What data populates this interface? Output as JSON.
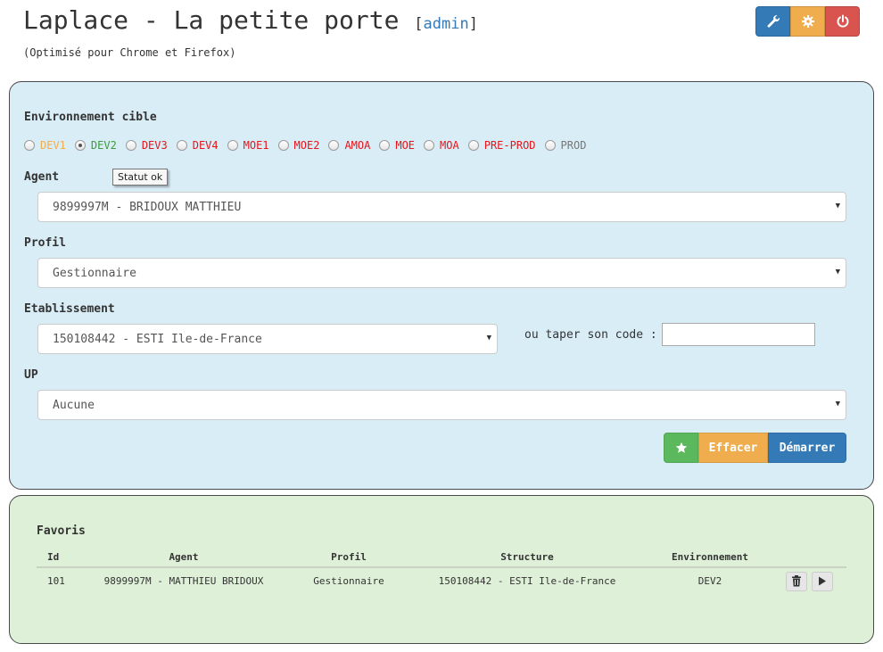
{
  "header": {
    "title": "Laplace - La petite porte",
    "bracket_open": "[",
    "admin_link": "admin",
    "bracket_close": "]",
    "subtitle": "(Optimisé pour Chrome et Firefox)"
  },
  "top_buttons": [
    {
      "icon": "wrench-icon",
      "color": "#337ab7"
    },
    {
      "icon": "gear-icon",
      "color": "#f0ad4e"
    },
    {
      "icon": "power-icon",
      "color": "#d9534f"
    }
  ],
  "form": {
    "env_label": "Environnement cible",
    "environments": [
      {
        "label": "DEV1",
        "color": "#f0ad4e",
        "checked": false
      },
      {
        "label": "DEV2",
        "color": "#3c9b3c",
        "checked": true
      },
      {
        "label": "DEV3",
        "color": "#e8141a",
        "checked": false
      },
      {
        "label": "DEV4",
        "color": "#e8141a",
        "checked": false
      },
      {
        "label": "MOE1",
        "color": "#e8141a",
        "checked": false
      },
      {
        "label": "MOE2",
        "color": "#e8141a",
        "checked": false
      },
      {
        "label": "AMOA",
        "color": "#e8141a",
        "checked": false
      },
      {
        "label": "MOE",
        "color": "#e8141a",
        "checked": false
      },
      {
        "label": "MOA",
        "color": "#e8141a",
        "checked": false
      },
      {
        "label": "PRE-PROD",
        "color": "#e8141a",
        "checked": false
      },
      {
        "label": "PROD",
        "color": "#777777",
        "checked": false
      }
    ],
    "tooltip": "Statut ok",
    "agent_label": "Agent",
    "agent_value": "9899997M - BRIDOUX MATTHIEU",
    "profil_label": "Profil",
    "profil_value": "Gestionnaire",
    "etab_label": "Etablissement",
    "etab_value": "150108442 - ESTI Ile-de-France",
    "code_label": "ou taper son code :",
    "code_value": "",
    "up_label": "UP",
    "up_value": "Aucune",
    "clear_label": "Effacer",
    "start_label": "Démarrer"
  },
  "favoris": {
    "title": "Favoris",
    "columns": [
      "Id",
      "Agent",
      "Profil",
      "Structure",
      "Environnement"
    ],
    "rows": [
      {
        "id": "101",
        "agent": "9899997M - MATTHIEU BRIDOUX",
        "profil": "Gestionnaire",
        "structure": "150108442 - ESTI Ile-de-France",
        "env": "DEV2"
      }
    ]
  }
}
